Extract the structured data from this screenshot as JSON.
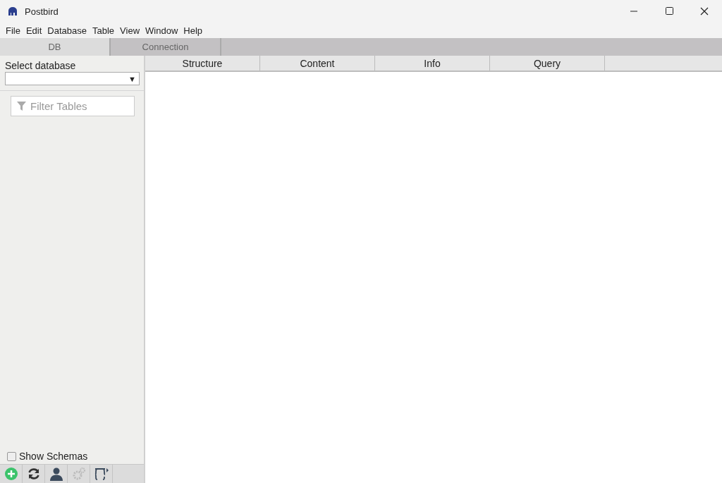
{
  "window": {
    "title": "Postbird"
  },
  "menu": [
    "File",
    "Edit",
    "Database",
    "Table",
    "View",
    "Window",
    "Help"
  ],
  "top_tabs": [
    {
      "label": "DB",
      "selected": true
    },
    {
      "label": "Connection",
      "selected": false
    }
  ],
  "sidebar": {
    "database_label": "Select database",
    "database_select": {
      "arrow": "▼"
    },
    "filter": {
      "placeholder": "Filter Tables"
    },
    "show_schemas": {
      "label": "Show Schemas",
      "checked": false
    },
    "toolbar": [
      {
        "kind": "add",
        "disabled": false
      },
      {
        "kind": "refresh",
        "disabled": false
      },
      {
        "kind": "user",
        "disabled": false
      },
      {
        "kind": "settings",
        "disabled": true
      },
      {
        "kind": "export",
        "disabled": false
      }
    ]
  },
  "content_tabs": [
    {
      "label": "Structure",
      "selected": false
    },
    {
      "label": "Content",
      "selected": false
    },
    {
      "label": "Info",
      "selected": false
    },
    {
      "label": "Query",
      "selected": false
    }
  ]
}
